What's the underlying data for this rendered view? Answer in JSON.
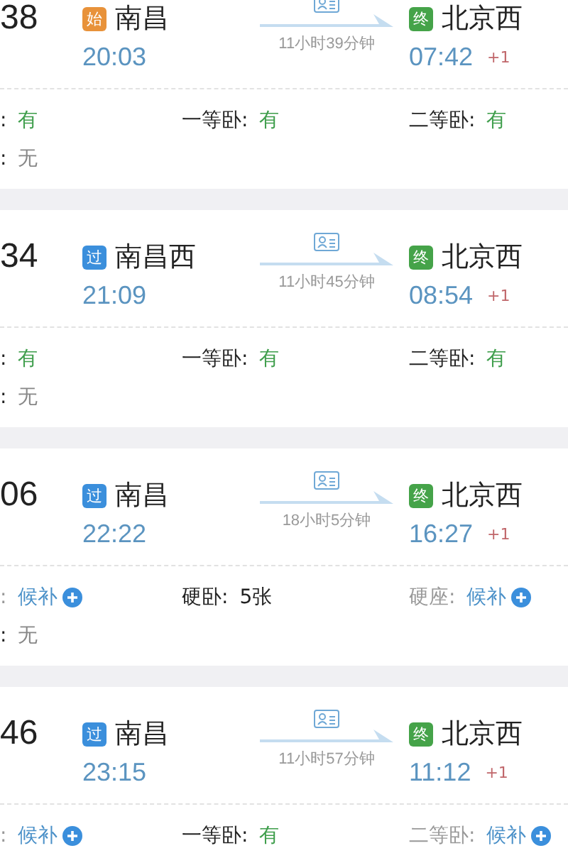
{
  "trains": [
    {
      "number": "38",
      "from": {
        "badge": "始",
        "kind": "start",
        "name": "南昌",
        "time": "20:03"
      },
      "duration": "11小时39分钟",
      "to": {
        "badge": "终",
        "kind": "end",
        "name": "北京西",
        "time": "07:42",
        "day_offset": "+1"
      },
      "seat_rows": [
        [
          {
            "label": ":",
            "value": "有",
            "kind": "available"
          },
          {
            "label": "一等卧:",
            "value": "有",
            "kind": "available"
          },
          {
            "label": "二等卧:",
            "value": "有",
            "kind": "available"
          }
        ],
        [
          {
            "label": ":",
            "value": "无",
            "kind": "none"
          }
        ]
      ]
    },
    {
      "number": "34",
      "from": {
        "badge": "过",
        "kind": "pass",
        "name": "南昌西",
        "time": "21:09"
      },
      "duration": "11小时45分钟",
      "to": {
        "badge": "终",
        "kind": "end",
        "name": "北京西",
        "time": "08:54",
        "day_offset": "+1"
      },
      "seat_rows": [
        [
          {
            "label": ":",
            "value": "有",
            "kind": "available"
          },
          {
            "label": "一等卧:",
            "value": "有",
            "kind": "available"
          },
          {
            "label": "二等卧:",
            "value": "有",
            "kind": "available"
          }
        ],
        [
          {
            "label": ":",
            "value": "无",
            "kind": "none"
          }
        ]
      ]
    },
    {
      "number": "06",
      "from": {
        "badge": "过",
        "kind": "pass",
        "name": "南昌",
        "time": "22:22"
      },
      "duration": "18小时5分钟",
      "to": {
        "badge": "终",
        "kind": "end",
        "name": "北京西",
        "time": "16:27",
        "day_offset": "+1"
      },
      "seat_rows": [
        [
          {
            "label": ":",
            "value": "候补",
            "kind": "waitlist"
          },
          {
            "label": "硬卧:",
            "value": "5张",
            "kind": "count"
          },
          {
            "label": "硬座:",
            "value": "候补",
            "kind": "waitlist"
          }
        ],
        [
          {
            "label": ":",
            "value": "无",
            "kind": "none"
          }
        ]
      ]
    },
    {
      "number": "46",
      "from": {
        "badge": "过",
        "kind": "pass",
        "name": "南昌",
        "time": "23:15"
      },
      "duration": "11小时57分钟",
      "to": {
        "badge": "终",
        "kind": "end",
        "name": "北京西",
        "time": "11:12",
        "day_offset": "+1"
      },
      "seat_rows": [
        [
          {
            "label": ":",
            "value": "候补",
            "kind": "waitlist"
          },
          {
            "label": "一等卧:",
            "value": "有",
            "kind": "available"
          },
          {
            "label": "二等卧:",
            "value": "候补",
            "kind": "waitlist"
          }
        ]
      ]
    }
  ]
}
